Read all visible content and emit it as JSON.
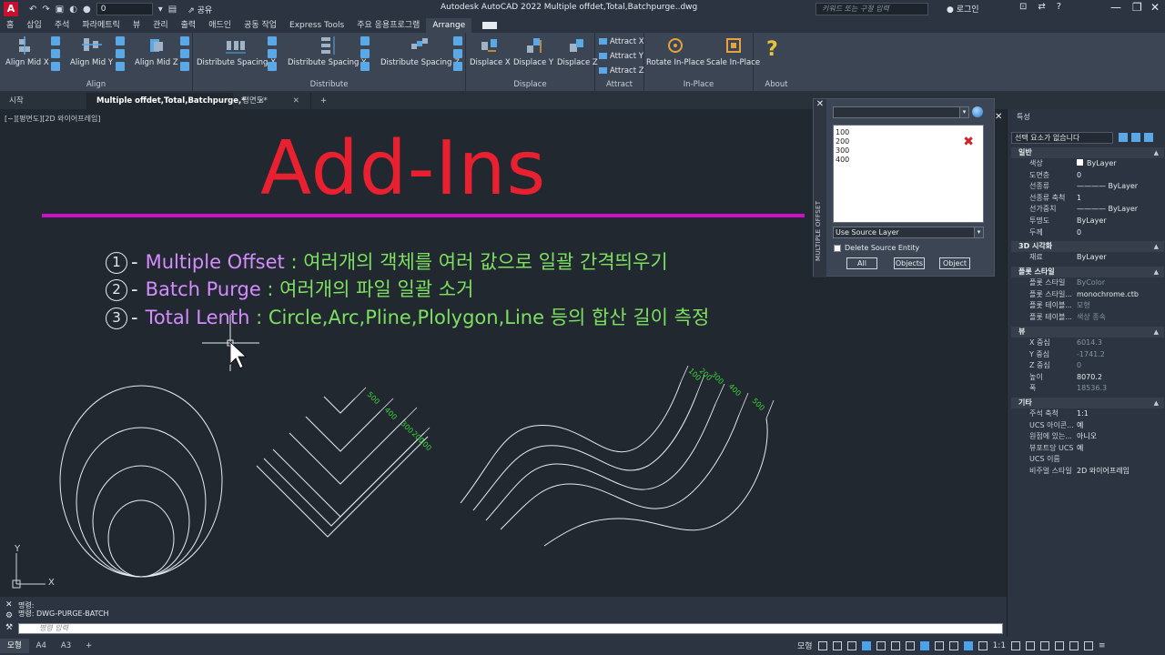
{
  "app": {
    "title": "Autodesk AutoCAD 2022     Multiple offdet,Total,Batchpurge..dwg",
    "logo_letter": "A",
    "layer_current": "0",
    "share_label": "공유",
    "search_placeholder": "키워드 또는 구절 입력",
    "login_label": "로그인"
  },
  "ribbon_tabs": [
    "홈",
    "삽입",
    "주석",
    "파라메트릭",
    "뷰",
    "관리",
    "출력",
    "애드인",
    "공동 작업",
    "Express Tools",
    "주요 응용프로그램",
    "Arrange"
  ],
  "ribbon_active_tab": "Arrange",
  "ribbon": {
    "align": {
      "title": "Align",
      "buttons": [
        "Align Mid X",
        "Align Mid Y",
        "Align Mid Z"
      ]
    },
    "distribute": {
      "title": "Distribute",
      "buttons": [
        "Distribute Spacing X",
        "Distribute Spacing Y",
        "Distribute Spacing Z"
      ]
    },
    "displace": {
      "title": "Displace",
      "buttons": [
        "Displace X",
        "Displace Y",
        "Displace Z"
      ]
    },
    "attract": {
      "title": "Attract",
      "buttons": [
        "Attract X",
        "Attract Y",
        "Attract Z"
      ]
    },
    "inplace": {
      "title": "In-Place",
      "buttons": [
        "Rotate In-Place",
        "Scale In-Place"
      ]
    },
    "about": {
      "title": "About",
      "glyph": "?"
    }
  },
  "doc_tabs": [
    {
      "label": "시작"
    },
    {
      "label": "Multiple offdet,Total,Batchpurge,*",
      "active": true
    },
    {
      "label": "평면도*"
    }
  ],
  "viewport_label": "[−][평면도][2D 와이어프레임]",
  "drawing": {
    "title": "Add-Ins",
    "features": [
      {
        "num": "1",
        "name": "Multiple Offset",
        "desc": " : 여러개의 객체를 여러 값으로 일괄 간격띄우기"
      },
      {
        "num": "2",
        "name": "Batch Purge",
        "desc": " : 여러개의 파일 일괄 소거"
      },
      {
        "num": "3",
        "name": "Total Lenth",
        "desc": " : Circle,Arc,Pline,Plolygon,Line 등의 합산 길이 측정"
      }
    ],
    "v_dims": [
      "500",
      "400",
      "300",
      "200",
      "100"
    ],
    "s_dims": [
      "100",
      "200",
      "300",
      "400",
      "500"
    ],
    "ucs_x": "X",
    "ucs_y": "Y"
  },
  "multiple_offset": {
    "title": "MULTIPLE OFFSET",
    "values": [
      "100",
      "200",
      "300",
      "400"
    ],
    "layer_option": "Use Source Layer",
    "delete_label": "Delete Source Entity",
    "buttons": [
      "All",
      "Objects",
      "Object"
    ]
  },
  "properties": {
    "title": "특성",
    "selection": "선택 요소가 없습니다",
    "sections": [
      {
        "name": "일반",
        "rows": [
          {
            "k": "색상",
            "v": "ByLayer"
          },
          {
            "k": "도면층",
            "v": "0"
          },
          {
            "k": "선종류",
            "v": "———— ByLayer"
          },
          {
            "k": "선종류 축척",
            "v": "1"
          },
          {
            "k": "선가중치",
            "v": "———— ByLayer"
          },
          {
            "k": "투명도",
            "v": "ByLayer"
          },
          {
            "k": "두께",
            "v": "0"
          }
        ]
      },
      {
        "name": "3D 시각화",
        "rows": [
          {
            "k": "재료",
            "v": "ByLayer"
          }
        ]
      },
      {
        "name": "플롯 스타일",
        "rows": [
          {
            "k": "플롯 스타일",
            "v": "ByColor",
            "dim": true
          },
          {
            "k": "플롯 스타일...",
            "v": "monochrome.ctb"
          },
          {
            "k": "플롯 테이블...",
            "v": "모형",
            "dim": true
          },
          {
            "k": "플롯 테이블...",
            "v": "색상 종속",
            "dim": true
          }
        ]
      },
      {
        "name": "뷰",
        "rows": [
          {
            "k": "X 중심",
            "v": "6014.3",
            "dim": true
          },
          {
            "k": "Y 중심",
            "v": "-1741.2",
            "dim": true
          },
          {
            "k": "Z 중심",
            "v": "0",
            "dim": true
          },
          {
            "k": "높이",
            "v": "8070.2"
          },
          {
            "k": "폭",
            "v": "18536.3",
            "dim": true
          }
        ]
      },
      {
        "name": "기타",
        "rows": [
          {
            "k": "주석 축척",
            "v": "1:1"
          },
          {
            "k": "UCS 아이콘...",
            "v": "예"
          },
          {
            "k": "원점에 있는...",
            "v": "아니오"
          },
          {
            "k": "뷰포트당 UCS",
            "v": "예"
          },
          {
            "k": "UCS 이름",
            "v": ""
          },
          {
            "k": "비주얼 스타일",
            "v": "2D 와이어프레임"
          }
        ]
      }
    ]
  },
  "command": {
    "history": [
      "명령:",
      "명령: DWG-PURGE-BATCH"
    ],
    "placeholder": "명령 입력"
  },
  "status": {
    "tabs": [
      "모형",
      "A4",
      "A3"
    ],
    "right_labels": [
      "모형",
      "1:1"
    ]
  },
  "colors": {
    "title_red": "#e8202f",
    "feature_name": "#d58cff",
    "feature_desc": "#7de061",
    "separator": "#cc10cc",
    "dim_green": "#3ad63a"
  }
}
